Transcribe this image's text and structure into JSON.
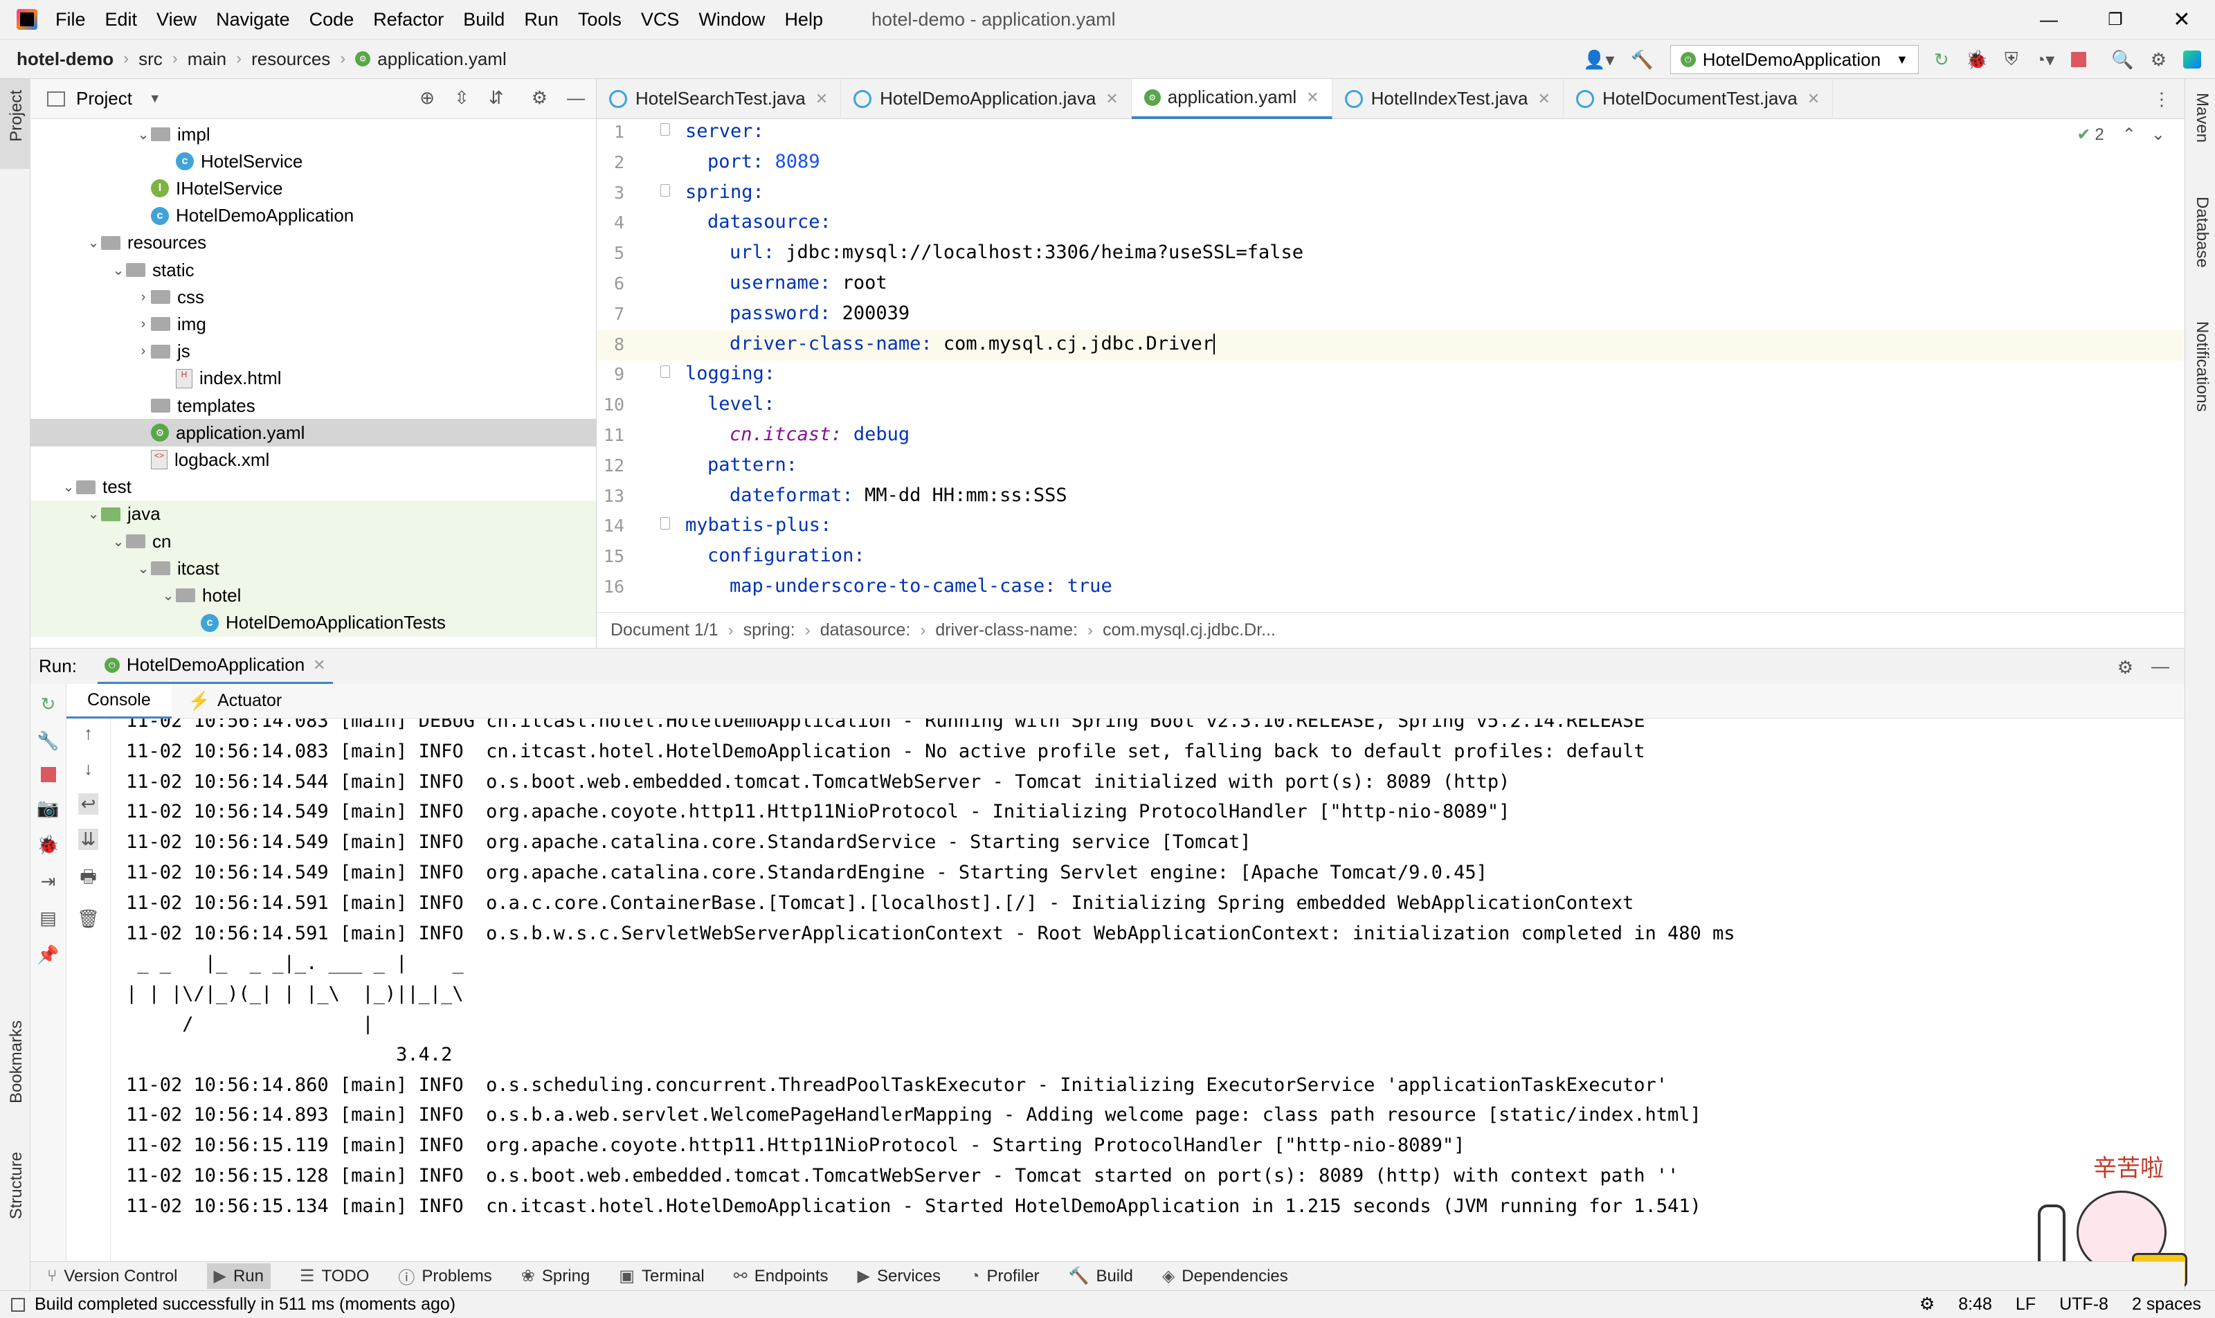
{
  "menubar": {
    "items": [
      "File",
      "Edit",
      "View",
      "Navigate",
      "Code",
      "Refactor",
      "Build",
      "Run",
      "Tools",
      "VCS",
      "Window",
      "Help"
    ],
    "window_title": "hotel-demo - application.yaml"
  },
  "breadcrumb": {
    "items": [
      "hotel-demo",
      "src",
      "main",
      "resources",
      "application.yaml"
    ]
  },
  "toolbar": {
    "run_config": "HotelDemoApplication"
  },
  "project": {
    "title": "Project",
    "tree": [
      {
        "label": "impl",
        "type": "folder",
        "indent": 4,
        "expanded": true
      },
      {
        "label": "HotelService",
        "type": "class",
        "indent": 5
      },
      {
        "label": "IHotelService",
        "type": "interface",
        "indent": 4
      },
      {
        "label": "HotelDemoApplication",
        "type": "spring",
        "indent": 4
      },
      {
        "label": "resources",
        "type": "folder",
        "indent": 2,
        "expanded": true
      },
      {
        "label": "static",
        "type": "folder",
        "indent": 3,
        "expanded": true
      },
      {
        "label": "css",
        "type": "folder",
        "indent": 4,
        "expanded": false
      },
      {
        "label": "img",
        "type": "folder",
        "indent": 4,
        "expanded": false
      },
      {
        "label": "js",
        "type": "folder",
        "indent": 4,
        "expanded": false
      },
      {
        "label": "index.html",
        "type": "html",
        "indent": 5
      },
      {
        "label": "templates",
        "type": "folder",
        "indent": 4
      },
      {
        "label": "application.yaml",
        "type": "yaml",
        "indent": 4,
        "selected": true
      },
      {
        "label": "logback.xml",
        "type": "xml",
        "indent": 4
      },
      {
        "label": "test",
        "type": "folder",
        "indent": 1,
        "expanded": true
      },
      {
        "label": "java",
        "type": "srcfolder",
        "indent": 2,
        "expanded": true
      },
      {
        "label": "cn",
        "type": "folder",
        "indent": 3,
        "expanded": true
      },
      {
        "label": "itcast",
        "type": "folder",
        "indent": 4,
        "expanded": true
      },
      {
        "label": "hotel",
        "type": "folder",
        "indent": 5,
        "expanded": true
      },
      {
        "label": "HotelDemoApplicationTests",
        "type": "testclass",
        "indent": 6
      }
    ]
  },
  "editor": {
    "tabs": [
      "HotelSearchTest.java",
      "HotelDemoApplication.java",
      "application.yaml",
      "HotelIndexTest.java",
      "HotelDocumentTest.java"
    ],
    "active_tab": 2,
    "inspections": "2",
    "lines": [
      {
        "n": "1",
        "key": "server:",
        "indent": 0
      },
      {
        "n": "2",
        "key": "port:",
        "val": "8089",
        "vtype": "num",
        "indent": 1
      },
      {
        "n": "3",
        "key": "spring:",
        "indent": 0
      },
      {
        "n": "4",
        "key": "datasource:",
        "indent": 1
      },
      {
        "n": "5",
        "key": "url:",
        "val": "jdbc:mysql://localhost:3306/heima?useSSL=false",
        "vtype": "plain",
        "indent": 2
      },
      {
        "n": "6",
        "key": "username:",
        "val": "root",
        "vtype": "plain",
        "indent": 2
      },
      {
        "n": "7",
        "key": "password:",
        "val": "200039",
        "vtype": "plain",
        "indent": 2
      },
      {
        "n": "8",
        "key": "driver-class-name:",
        "val": "com.mysql.cj.jdbc.Driver",
        "vtype": "plain",
        "indent": 2,
        "current": true
      },
      {
        "n": "9",
        "key": "logging:",
        "indent": 0
      },
      {
        "n": "10",
        "key": "level:",
        "indent": 1
      },
      {
        "n": "11",
        "key": "cn.itcast:",
        "val": "debug",
        "vtype": "kw",
        "indent": 2,
        "italic": true
      },
      {
        "n": "12",
        "key": "pattern:",
        "indent": 1
      },
      {
        "n": "13",
        "key": "dateformat:",
        "val": "MM-dd HH:mm:ss:SSS",
        "vtype": "plain",
        "indent": 2
      },
      {
        "n": "14",
        "key": "mybatis-plus:",
        "indent": 0
      },
      {
        "n": "15",
        "key": "configuration:",
        "indent": 1
      },
      {
        "n": "16",
        "key": "map-underscore-to-camel-case:",
        "val": "true",
        "vtype": "kw",
        "indent": 2
      }
    ],
    "doc_breadcrumb": [
      "Document 1/1",
      "spring:",
      "datasource:",
      "driver-class-name:",
      "com.mysql.cj.jdbc.Dr..."
    ]
  },
  "run": {
    "label": "Run:",
    "config": "HotelDemoApplication",
    "tabs": [
      "Console",
      "Actuator"
    ],
    "console": [
      "11-02 10:56:14.083 [main] DEBUG cn.itcast.hotel.HotelDemoApplication - Running with Spring Boot v2.3.10.RELEASE, Spring v5.2.14.RELEASE",
      "11-02 10:56:14.083 [main] INFO  cn.itcast.hotel.HotelDemoApplication - No active profile set, falling back to default profiles: default",
      "11-02 10:56:14.544 [main] INFO  o.s.boot.web.embedded.tomcat.TomcatWebServer - Tomcat initialized with port(s): 8089 (http)",
      "11-02 10:56:14.549 [main] INFO  org.apache.coyote.http11.Http11NioProtocol - Initializing ProtocolHandler [\"http-nio-8089\"]",
      "11-02 10:56:14.549 [main] INFO  org.apache.catalina.core.StandardService - Starting service [Tomcat]",
      "11-02 10:56:14.549 [main] INFO  org.apache.catalina.core.StandardEngine - Starting Servlet engine: [Apache Tomcat/9.0.45]",
      "11-02 10:56:14.591 [main] INFO  o.a.c.core.ContainerBase.[Tomcat].[localhost].[/] - Initializing Spring embedded WebApplicationContext",
      "11-02 10:56:14.591 [main] INFO  o.s.b.w.s.c.ServletWebServerApplicationContext - Root WebApplicationContext: initialization completed in 480 ms",
      " _ _   |_  _ _|_. ___ _ |    _",
      "| | |\\/|_)(_| | |_\\  |_)||_|_\\",
      "     /               |",
      "                        3.4.2",
      "11-02 10:56:14.860 [main] INFO  o.s.scheduling.concurrent.ThreadPoolTaskExecutor - Initializing ExecutorService 'applicationTaskExecutor'",
      "11-02 10:56:14.893 [main] INFO  o.s.b.a.web.servlet.WelcomePageHandlerMapping - Adding welcome page: class path resource [static/index.html]",
      "11-02 10:56:15.119 [main] INFO  org.apache.coyote.http11.Http11NioProtocol - Starting ProtocolHandler [\"http-nio-8089\"]",
      "11-02 10:56:15.128 [main] INFO  o.s.boot.web.embedded.tomcat.TomcatWebServer - Tomcat started on port(s): 8089 (http) with context path ''",
      "11-02 10:56:15.134 [main] INFO  cn.itcast.hotel.HotelDemoApplication - Started HotelDemoApplication in 1.215 seconds (JVM running for 1.541)"
    ]
  },
  "left_stripe": {
    "project": "Project",
    "bookmarks": "Bookmarks",
    "structure": "Structure"
  },
  "right_stripe": {
    "maven": "Maven",
    "database": "Database",
    "notifications": "Notifications"
  },
  "toolwindows": [
    "Version Control",
    "Run",
    "TODO",
    "Problems",
    "Spring",
    "Terminal",
    "Endpoints",
    "Services",
    "Profiler",
    "Build",
    "Dependencies"
  ],
  "status": {
    "message": "Build completed successfully in 511 ms (moments ago)",
    "position": "8:48",
    "line_sep": "LF",
    "encoding": "UTF-8",
    "indent": "2 spaces"
  },
  "sticker": {
    "text": "辛苦啦"
  },
  "colors": {
    "key": "#0033b3",
    "number": "#1750eb",
    "selection": "#d5d5d5",
    "active_tab_underline": "#4083c9",
    "run_green": "#59a869",
    "stop_red": "#db5860"
  }
}
